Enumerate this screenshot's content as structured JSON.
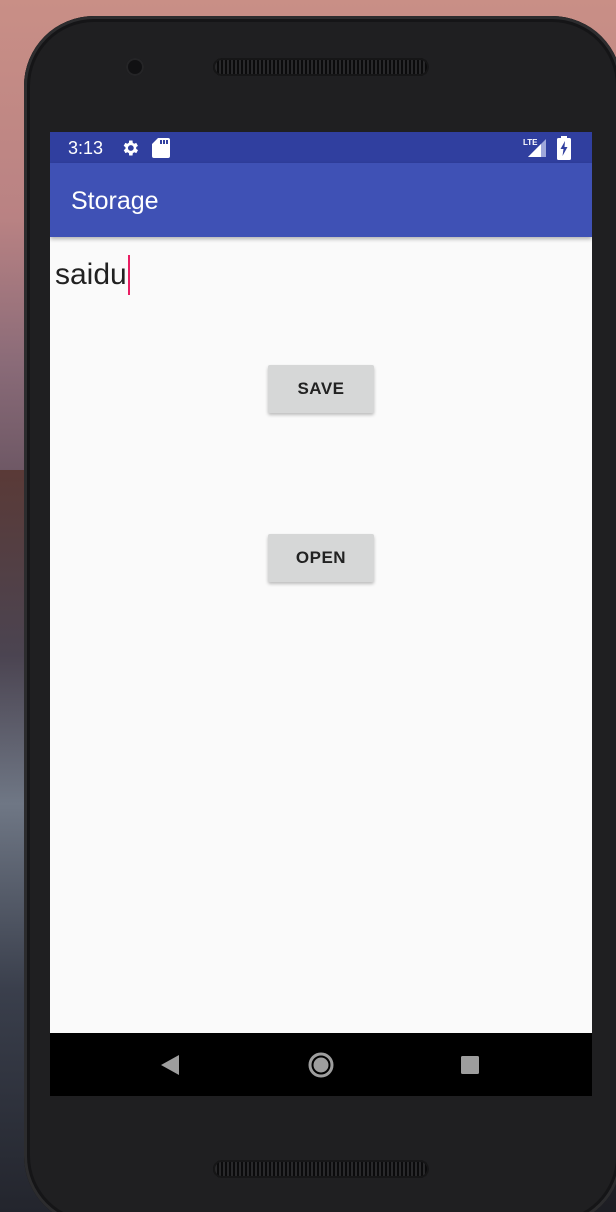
{
  "status_bar": {
    "time": "3:13",
    "icons": [
      "gear-icon",
      "sd-card-icon",
      "lte-signal-icon",
      "battery-charging-icon"
    ],
    "network_label": "LTE"
  },
  "app_bar": {
    "title": "Storage"
  },
  "main": {
    "edit_text_value": "saidu",
    "save_label": "SAVE",
    "open_label": "OPEN"
  },
  "nav_bar": {
    "icons": [
      "back-icon",
      "home-icon",
      "recents-icon"
    ]
  },
  "colors": {
    "status_bar": "#303f9f",
    "app_bar": "#3f51b5",
    "accent": "#e91e63",
    "button": "#d6d7d7",
    "background": "#fafafa"
  }
}
